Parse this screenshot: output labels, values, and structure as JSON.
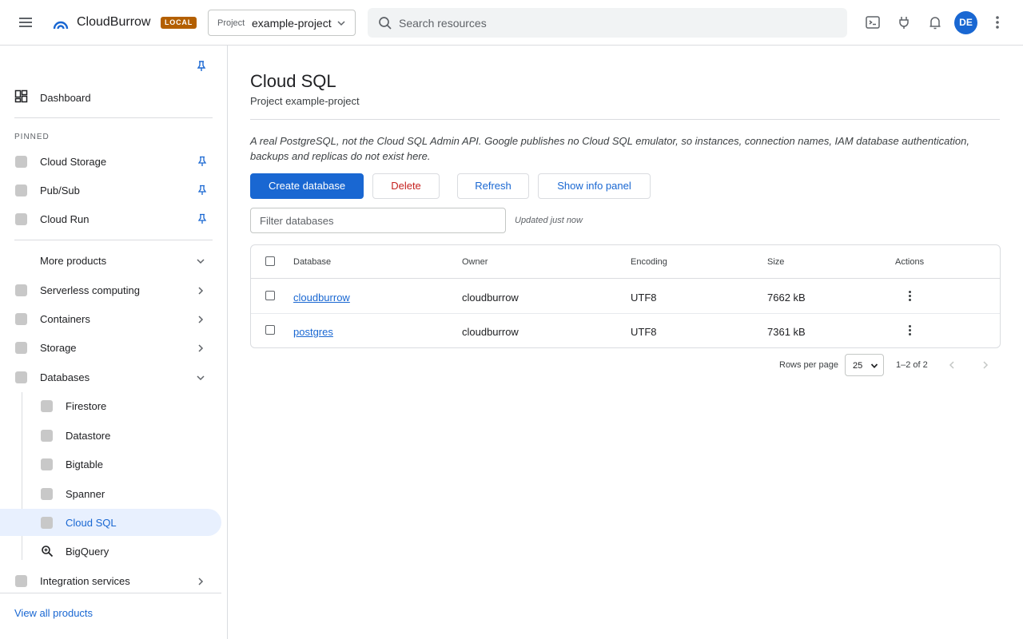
{
  "app": {
    "title": "CloudBurrow",
    "badge": "LOCAL",
    "project_label": "Project",
    "project_value": "example-project",
    "search_placeholder": "Search resources",
    "avatar_initials": "DE",
    "colors": {
      "accent": "#1967d2",
      "badge": "#b35f00",
      "danger": "#c5221f"
    }
  },
  "sidebar": {
    "dashboard": "Dashboard",
    "pinned_header": "PINNED",
    "pinned": [
      {
        "label": "Cloud Storage",
        "icon": "pin-icon"
      },
      {
        "label": "Pub/Sub",
        "icon": "pin-icon"
      },
      {
        "label": "Cloud Run",
        "icon": "pin-icon"
      }
    ],
    "more_products": "More products",
    "categories": [
      {
        "label": "Serverless computing"
      },
      {
        "label": "Containers"
      },
      {
        "label": "Storage"
      },
      {
        "label": "Databases"
      }
    ],
    "database_items": [
      {
        "label": "Firestore"
      },
      {
        "label": "Datastore"
      },
      {
        "label": "Bigtable"
      },
      {
        "label": "Spanner"
      },
      {
        "label": "Cloud SQL",
        "active": true
      },
      {
        "label": "BigQuery",
        "icon": "query-search-icon"
      }
    ],
    "integration": "Integration services",
    "view_all": "View all products"
  },
  "main": {
    "title": "Cloud SQL",
    "subtitle": "Project example-project",
    "note": "A real PostgreSQL, not the Cloud SQL Admin API. Google publishes no Cloud SQL emulator, so instances, connection names, IAM database authentication, backups and replicas do not exist here.",
    "buttons": {
      "create": "Create database",
      "delete": "Delete",
      "refresh": "Refresh",
      "info": "Show info panel"
    },
    "filter_placeholder": "Filter databases",
    "updated": "Updated just now",
    "table": {
      "columns": [
        "Database",
        "Owner",
        "Encoding",
        "Size",
        "Actions"
      ],
      "rows": [
        {
          "database": "cloudburrow",
          "owner": "cloudburrow",
          "encoding": "UTF8",
          "size": "7662 kB"
        },
        {
          "database": "postgres",
          "owner": "cloudburrow",
          "encoding": "UTF8",
          "size": "7361 kB"
        }
      ]
    },
    "pagination": {
      "rows_per_page_label": "Rows per page",
      "rows_per_page": "25",
      "range": "1–2 of 2"
    }
  }
}
